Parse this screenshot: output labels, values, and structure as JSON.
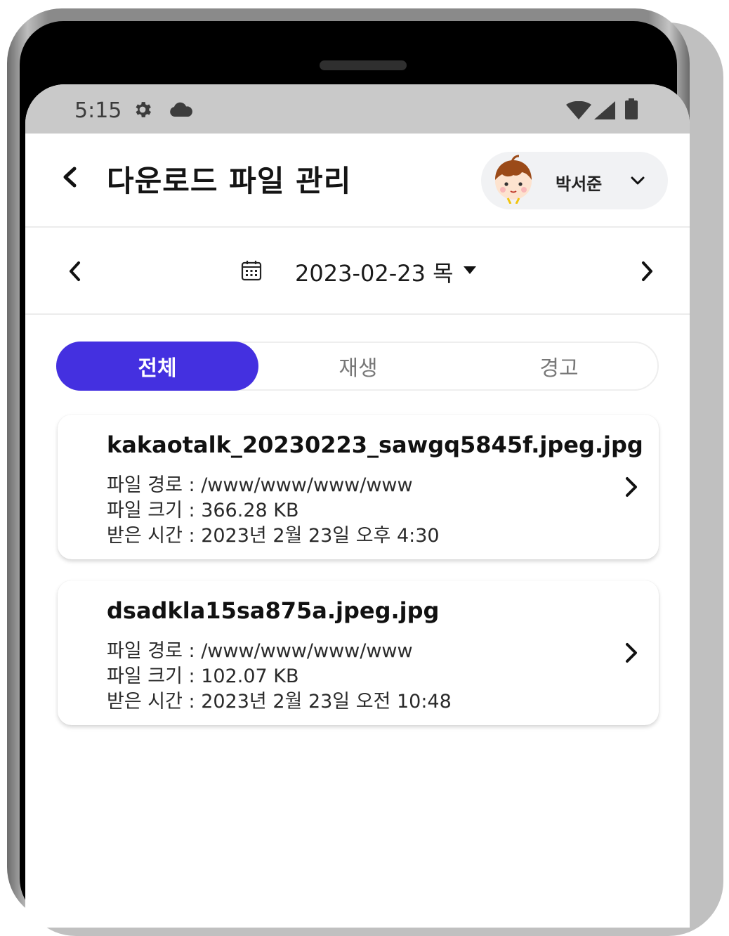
{
  "status_bar": {
    "time": "5:15",
    "left_icons": [
      "gear-icon",
      "cloud-icon"
    ],
    "right_icons": [
      "wifi-icon",
      "signal-icon",
      "battery-icon"
    ]
  },
  "header": {
    "title": "다운로드 파일 관리",
    "user_name": "박서준"
  },
  "date_nav": {
    "date": "2023-02-23 목"
  },
  "tabs": [
    {
      "label": "전체",
      "active": true
    },
    {
      "label": "재생",
      "active": false
    },
    {
      "label": "경고",
      "active": false
    }
  ],
  "files": [
    {
      "name": "kakaotalk_20230223_sawgq5845f.jpeg.jpg",
      "path": "파일 경로 : /www/www/www/www",
      "size": "파일 크기 : 366.28 KB",
      "received": "받은 시간 : 2023년 2월 23일 오후 4:30"
    },
    {
      "name": "dsadkla15sa875a.jpeg.jpg",
      "path": "파일 경로 : /www/www/www/www",
      "size": "파일 크기 : 102.07 KB",
      "received": "받은 시간 : 2023년 2월 23일 오전 10:48"
    }
  ],
  "colors": {
    "accent": "#4430e0",
    "status_bar_bg": "#c9c9c9"
  }
}
